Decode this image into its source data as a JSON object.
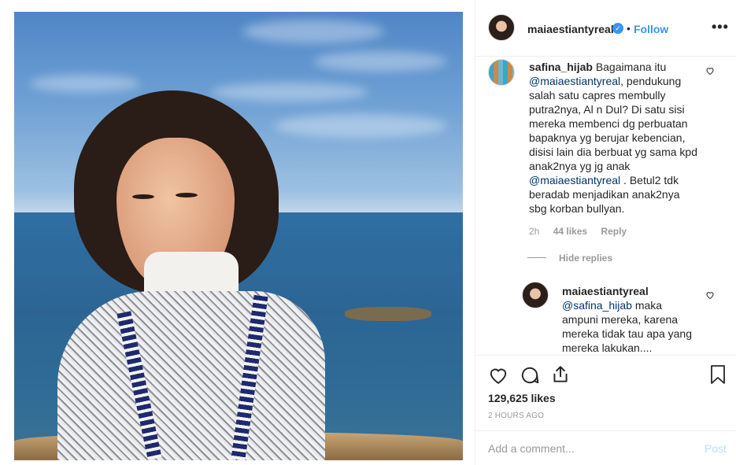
{
  "header": {
    "username": "maiaestiantyreal",
    "verified_icon": "verified-check-icon",
    "separator": "•",
    "follow_label": "Follow",
    "more_label": "•••"
  },
  "comment": {
    "username": "safina_hijab",
    "text_1": "Bagaimana itu",
    "mention_1": "@maiaestiantyreal",
    "text_2": ", pendukung salah satu capres membully putra2nya, Al n Dul? Di satu sisi mereka membenci dg perbuatan bapaknya yg berujar kebencian, disisi lain dia berbuat yg sama kpd anak2nya yg jg anak",
    "mention_2": "@maiaestiantyreal",
    "text_3": ". Betul2 tdk beradab menjadikan anak2nya sbg korban bullyan.",
    "time": "2h",
    "likes": "44 likes",
    "reply_label": "Reply",
    "hide_replies_label": "Hide replies"
  },
  "reply": {
    "username": "maiaestiantyreal",
    "mention": "@safina_hijab",
    "text": " maka ampuni mereka, karena mereka tidak tau apa yang mereka lakukan...."
  },
  "actions": {
    "likes": "129,625 likes",
    "time_ago": "2 HOURS AGO"
  },
  "comment_box": {
    "placeholder": "Add a comment...",
    "post_label": "Post"
  },
  "colors": {
    "accent": "#3897f0",
    "mention": "#003569",
    "muted": "#999999",
    "post_disabled": "#b2dffc"
  }
}
